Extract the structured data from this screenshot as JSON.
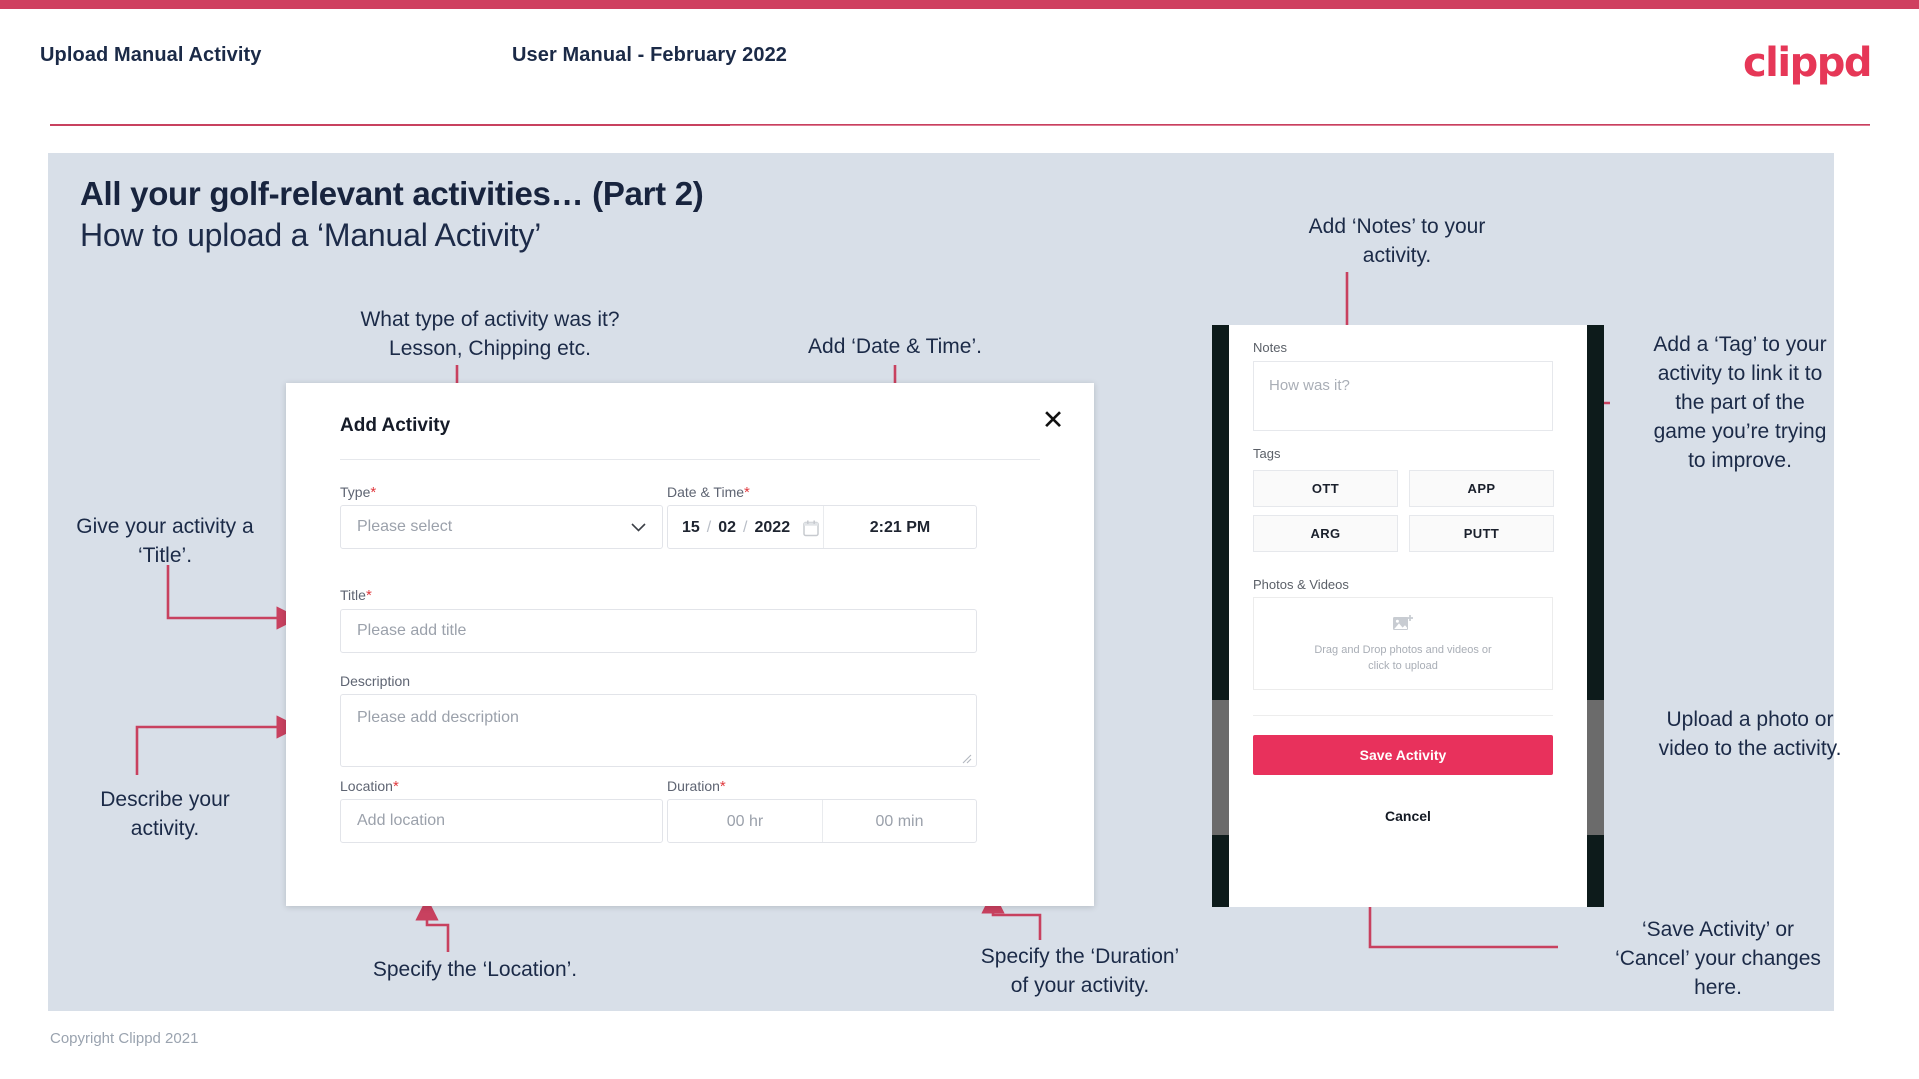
{
  "header": {
    "left_title": "Upload Manual Activity",
    "center_title": "User Manual - February 2022",
    "logo": "clippd"
  },
  "slide": {
    "heading": "All your golf-relevant activities… (Part 2)",
    "subheading": "How to upload a ‘Manual Activity’",
    "footer": "Copyright Clippd 2021"
  },
  "colors": {
    "accent_pink": "#e8315c",
    "header_rule": "#c8415f",
    "slide_bg": "#d8dfe8",
    "heading": "#18243e",
    "annotation": "#1b2a47",
    "required_star": "#e0393e"
  },
  "annotations": {
    "type": "What type of activity was it?\nLesson, Chipping etc.",
    "type_line1": "What type of activity was it?",
    "type_line2": "Lesson, Chipping etc.",
    "datetime": "Add ‘Date & Time’.",
    "title": "Give your activity a\n‘Title’.",
    "title_line1": "Give your activity a",
    "title_line2": "‘Title’.",
    "description_line1": "Describe your",
    "description_line2": "activity.",
    "location": "Specify the ‘Location’.",
    "duration_line1": "Specify the ‘Duration’",
    "duration_line2": "of your activity.",
    "notes_line1": "Add ‘Notes’ to your",
    "notes_line2": "activity.",
    "tags": "Add a ‘Tag’ to your activity to link it to the part of the game you’re trying to improve.",
    "tags_l1": "Add a ‘Tag’ to your",
    "tags_l2": "activity to link it to",
    "tags_l3": "the part of the",
    "tags_l4": "game you’re trying",
    "tags_l5": "to improve.",
    "upload_l1": "Upload a photo or",
    "upload_l2": "video to the activity.",
    "save_l1": "‘Save Activity’ or",
    "save_l2": "‘Cancel’ your changes",
    "save_l3": "here."
  },
  "dialog": {
    "title": "Add Activity",
    "close_icon": "close-icon",
    "fields": {
      "type": {
        "label": "Type",
        "required": "*",
        "placeholder": "Please select",
        "chevron": "chevron-down-icon"
      },
      "datetime": {
        "label": "Date & Time",
        "required": "*",
        "day": "15",
        "month": "02",
        "year": "2022",
        "sep": "/",
        "calendar_icon": "calendar-icon",
        "time": "2:21 PM"
      },
      "title": {
        "label": "Title",
        "required": "*",
        "placeholder": "Please add title"
      },
      "description": {
        "label": "Description",
        "required": "",
        "placeholder": "Please add description"
      },
      "location": {
        "label": "Location",
        "required": "*",
        "placeholder": "Add location"
      },
      "duration": {
        "label": "Duration",
        "required": "*",
        "hours_placeholder": "00 hr",
        "minutes_placeholder": "00 min"
      }
    }
  },
  "phone": {
    "notes": {
      "label": "Notes",
      "placeholder": "How was it?"
    },
    "tags": {
      "label": "Tags",
      "items": [
        "OTT",
        "APP",
        "ARG",
        "PUTT"
      ]
    },
    "photos": {
      "label": "Photos & Videos",
      "icon": "add-image-icon",
      "drop_line1": "Drag and Drop photos and videos or",
      "drop_line2": "click to upload"
    },
    "save_label": "Save Activity",
    "cancel_label": "Cancel"
  }
}
